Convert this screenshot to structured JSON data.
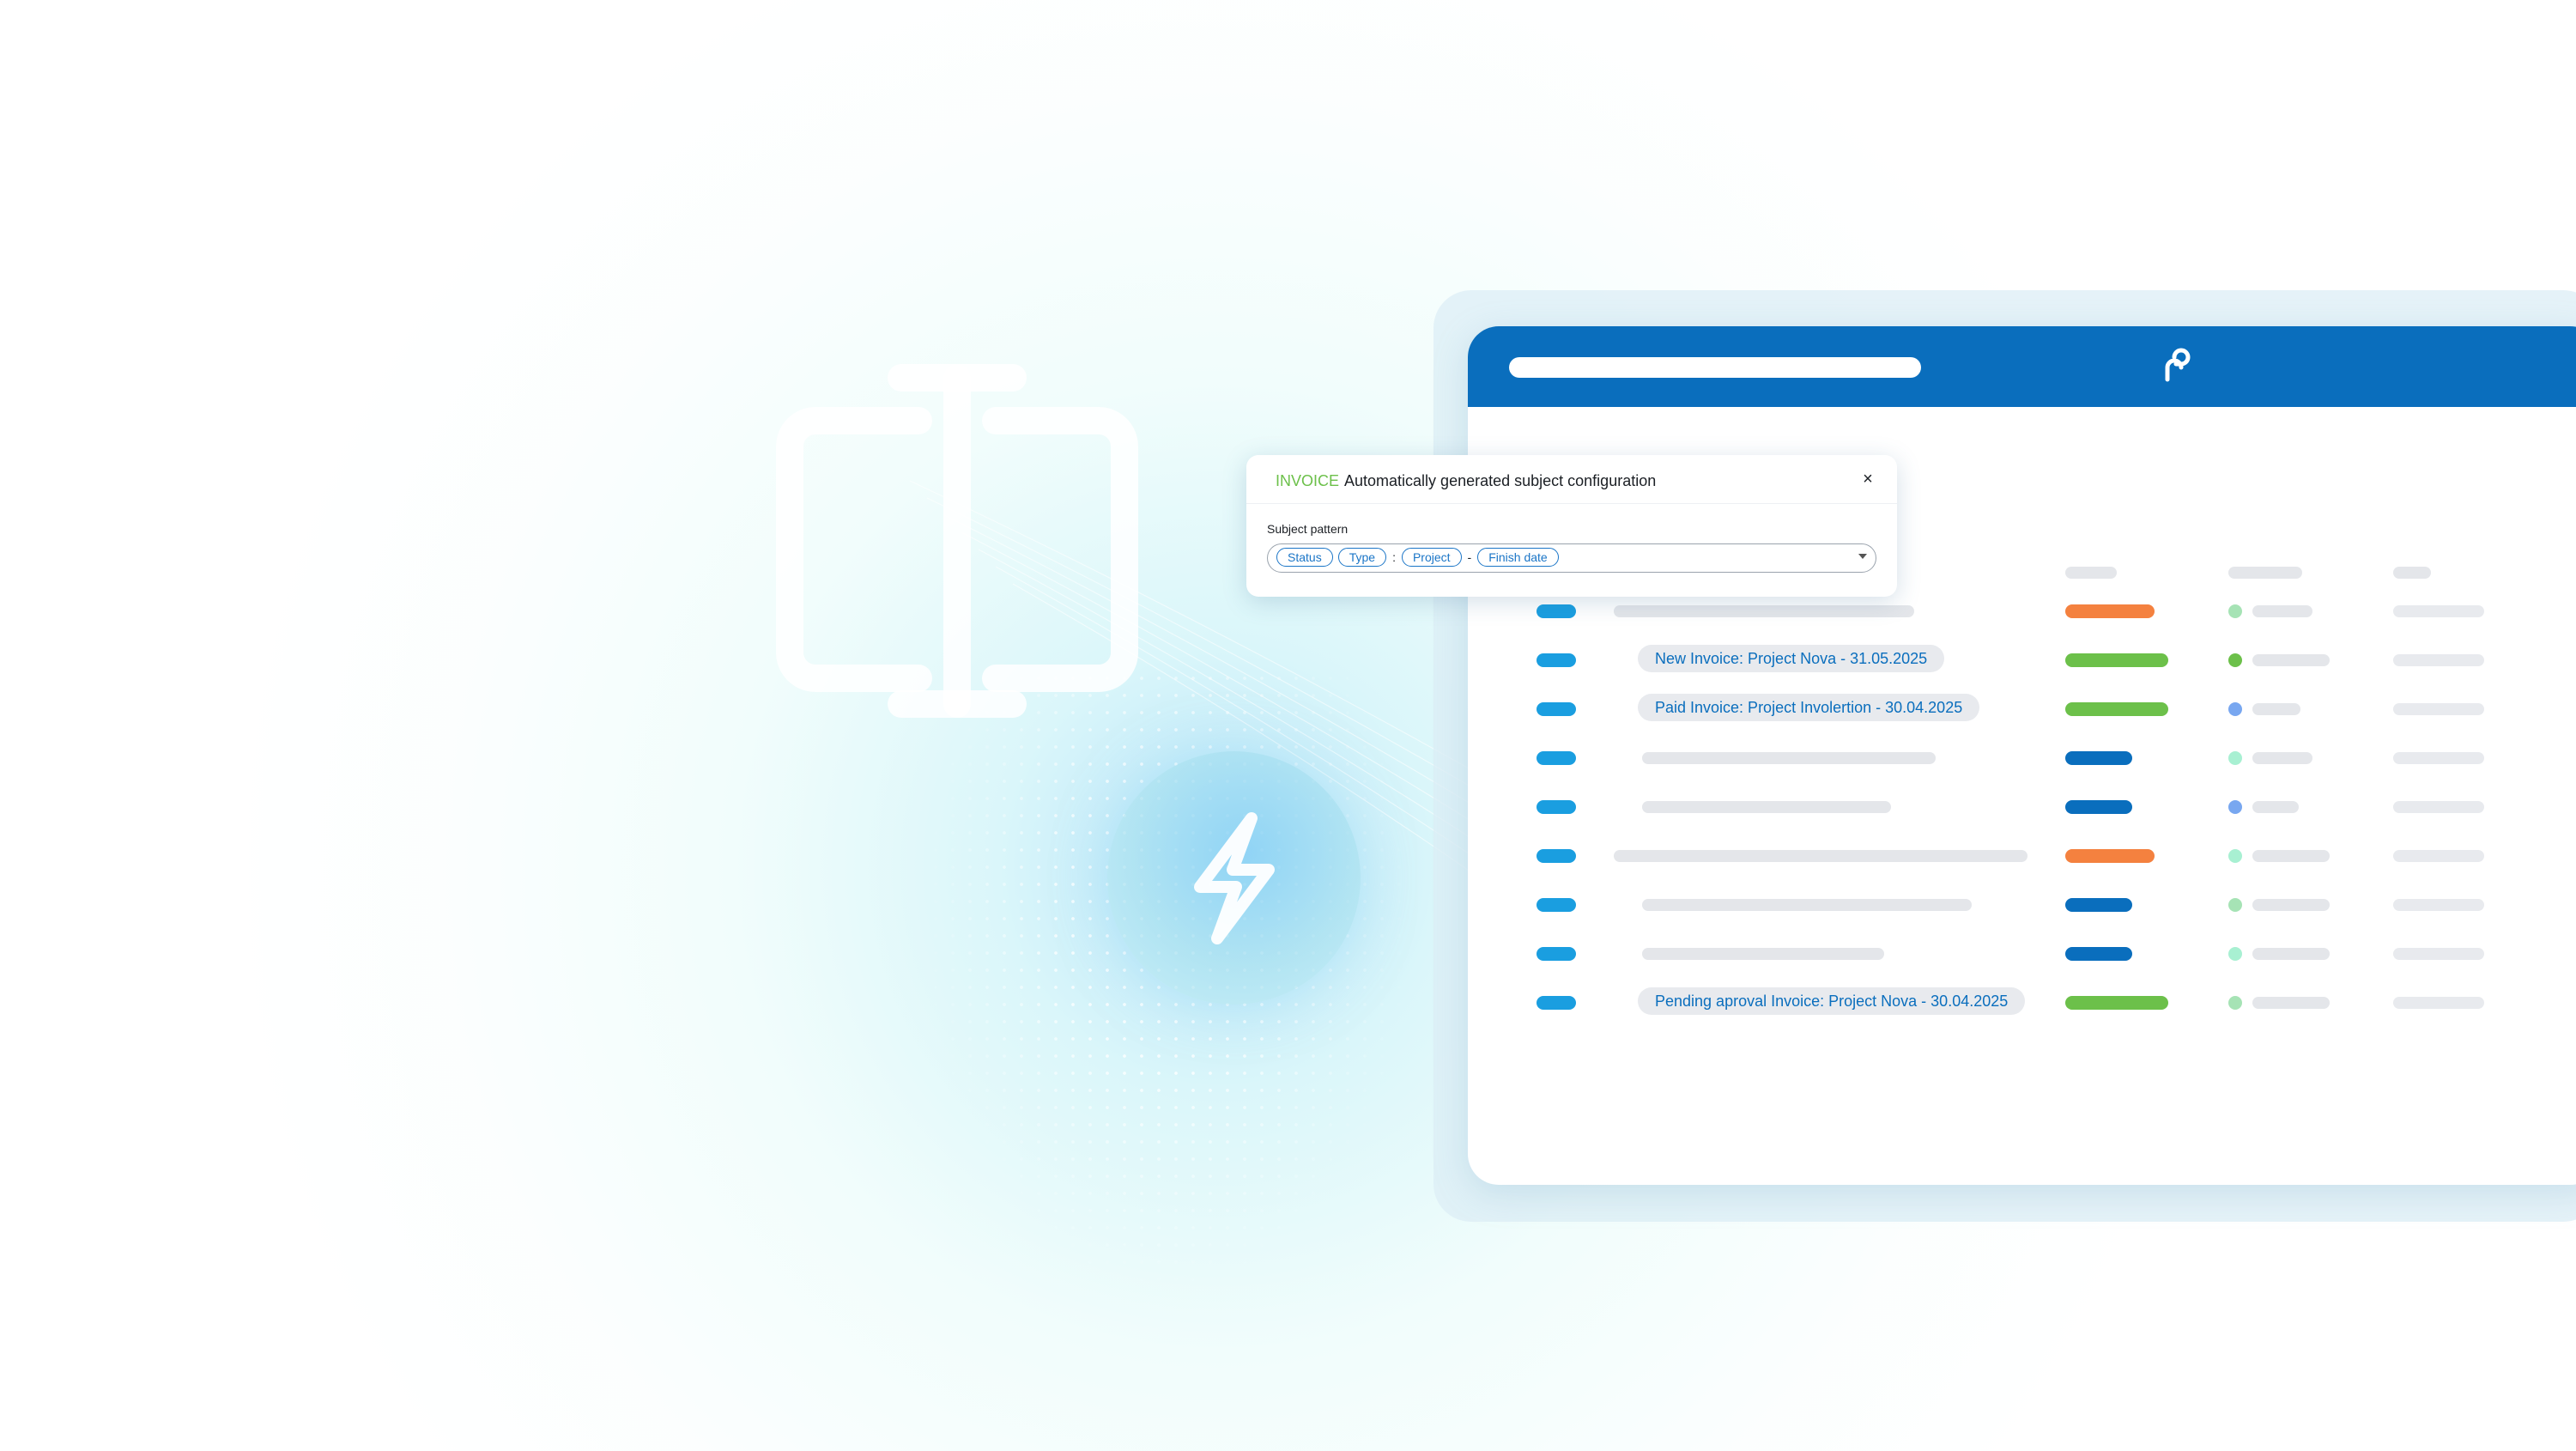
{
  "colors": {
    "brand_blue": "#0a6ebd",
    "accent_cyan": "#1a9ee0",
    "status_orange": "#f4813f",
    "status_green": "#6cc04a",
    "status_navy": "#0a6ebd",
    "dot_light_green": "#a6e3b5",
    "dot_green": "#6cc04a",
    "dot_blue": "#78a7f0",
    "dot_mint": "#a8f0d2"
  },
  "icons": {
    "decor_cursor": "text-cursor-icon",
    "decor_bolt": "lightning-bolt-icon",
    "app_logo": "link-logo-icon",
    "close": "close-icon",
    "dropdown": "chevron-down-icon"
  },
  "modal": {
    "kind": "INVOICE",
    "title": "Automatically generated subject configuration",
    "close_label": "×",
    "field_label": "Subject pattern",
    "tokens": [
      "Status",
      "Type",
      "Project",
      "Finish date"
    ],
    "separators": [
      ":",
      "-"
    ]
  },
  "table": {
    "rows": [
      {
        "subject": "",
        "status": "orange",
        "dot": "dot_light_green"
      },
      {
        "subject": "New Invoice: Project Nova - 31.05.2025",
        "status": "green",
        "dot": "dot_green"
      },
      {
        "subject": "Paid Invoice: Project Involertion - 30.04.2025",
        "status": "green",
        "dot": "dot_blue"
      },
      {
        "subject": "",
        "status": "navy",
        "dot": "dot_mint"
      },
      {
        "subject": "",
        "status": "navy",
        "dot": "dot_blue"
      },
      {
        "subject": "",
        "status": "orange",
        "dot": "dot_mint"
      },
      {
        "subject": "",
        "status": "navy",
        "dot": "dot_light_green"
      },
      {
        "subject": "",
        "status": "navy",
        "dot": "dot_mint"
      },
      {
        "subject": "Pending aproval Invoice: Project Nova - 30.04.2025",
        "status": "green",
        "dot": "dot_light_green"
      }
    ]
  }
}
